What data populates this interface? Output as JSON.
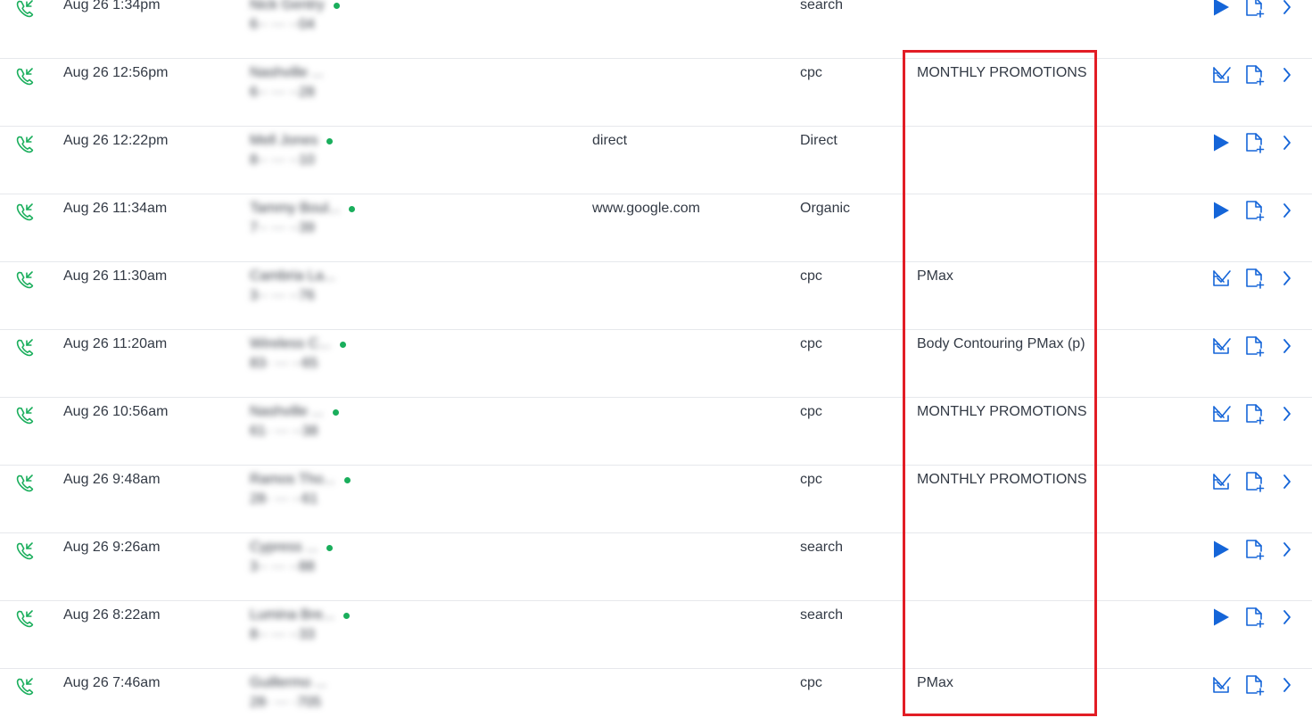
{
  "colors": {
    "accent": "#1565d8",
    "call_icon": "#1aae5c",
    "online_dot": "#1aae5c",
    "highlight": "#e21d25"
  },
  "icons": {
    "call_type": "phone-incoming-icon",
    "play": "play-icon",
    "review": "checklist-review-icon",
    "note": "add-note-icon",
    "open": "chevron-right-icon"
  },
  "calls": [
    {
      "date": "Aug 26 1:34pm",
      "caller_name": "Nick Gentry",
      "caller_phone": "6·· ··· ··04",
      "online": true,
      "source": "",
      "medium": "search",
      "campaign": "",
      "action": "play"
    },
    {
      "date": "Aug 26 12:56pm",
      "caller_name": "Nashville ...",
      "caller_phone": "6·· ··· ··28",
      "online": false,
      "source": "",
      "medium": "cpc",
      "campaign": "MONTHLY PROMOTIONS",
      "action": "review"
    },
    {
      "date": "Aug 26 12:22pm",
      "caller_name": "Mell Jones",
      "caller_phone": "8·· ··· ··10",
      "online": true,
      "source": "direct",
      "medium": "Direct",
      "campaign": "",
      "action": "play"
    },
    {
      "date": "Aug 26 11:34am",
      "caller_name": "Tammy Boul...",
      "caller_phone": "7·· ··· ··39",
      "online": true,
      "source": "www.google.com",
      "medium": "Organic",
      "campaign": "",
      "action": "play"
    },
    {
      "date": "Aug 26 11:30am",
      "caller_name": "Cambria La...",
      "caller_phone": "3·· ··· ··76",
      "online": false,
      "source": "",
      "medium": "cpc",
      "campaign": "PMax",
      "action": "review"
    },
    {
      "date": "Aug 26 11:20am",
      "caller_name": "Wireless C...",
      "caller_phone": "83· ··· ··65",
      "online": true,
      "source": "",
      "medium": "cpc",
      "campaign": "Body Contouring PMax (p)",
      "action": "review"
    },
    {
      "date": "Aug 26 10:56am",
      "caller_name": "Nashville ...",
      "caller_phone": "61· ··· ··38",
      "online": true,
      "source": "",
      "medium": "cpc",
      "campaign": "MONTHLY PROMOTIONS",
      "action": "review"
    },
    {
      "date": "Aug 26 9:48am",
      "caller_name": "Ramos Tho...",
      "caller_phone": "28· ··· ··61",
      "online": true,
      "source": "",
      "medium": "cpc",
      "campaign": "MONTHLY PROMOTIONS",
      "action": "review"
    },
    {
      "date": "Aug 26 9:26am",
      "caller_name": "Cypress ...",
      "caller_phone": "3·· ··· ··88",
      "online": true,
      "source": "",
      "medium": "search",
      "campaign": "",
      "action": "play"
    },
    {
      "date": "Aug 26 8:22am",
      "caller_name": "Lumina Bre...",
      "caller_phone": "8·· ··· ··33",
      "online": true,
      "source": "",
      "medium": "search",
      "campaign": "",
      "action": "play"
    },
    {
      "date": "Aug 26 7:46am",
      "caller_name": "Guillermo ...",
      "caller_phone": "28· ··· ·705",
      "online": false,
      "source": "",
      "medium": "cpc",
      "campaign": "PMax",
      "action": "review"
    }
  ]
}
